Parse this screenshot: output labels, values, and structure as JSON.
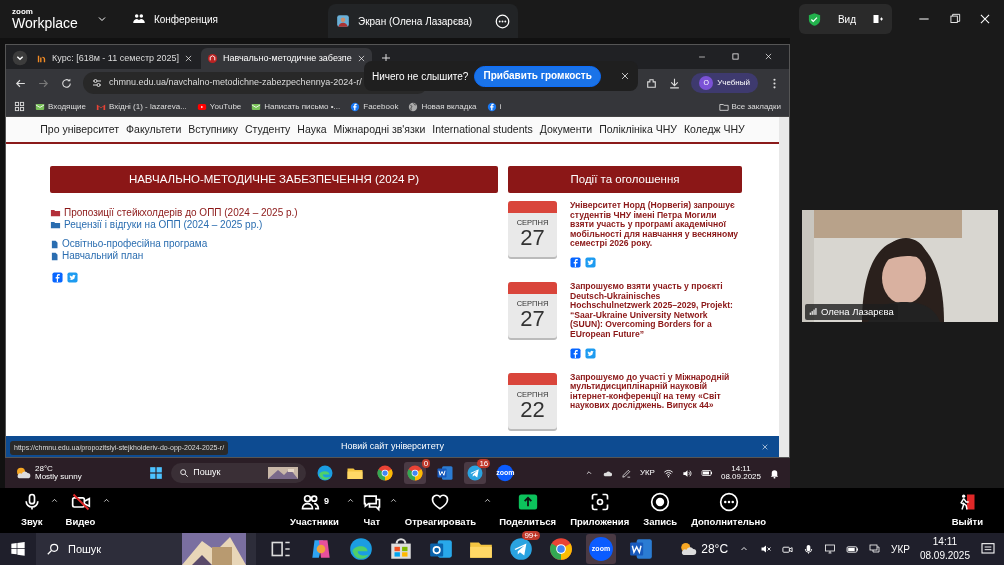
{
  "top_bar": {
    "logo_top": "zoom",
    "logo_bottom": "Workplace",
    "meeting": "Конференция",
    "share_tab": "Экран (Олена Лазарєва)",
    "view_button": "Вид"
  },
  "browser": {
    "tabs": [
      {
        "title": "Курс: [618м - 11 семестр 2025]",
        "selected": false,
        "kind": "course"
      },
      {
        "title": "Навчально-методичне забезпе",
        "selected": true,
        "kind": "site"
      }
    ],
    "url": "chmnu.edu.ua/navchalno-metodichne-zabezpechennya-2024-r/",
    "popup": {
      "message": "Ничего не слышите?",
      "button": "Прибавить громкость"
    },
    "profile_initial": "О",
    "profile": "Учебный",
    "bookmarks": [
      {
        "label": "Входящие",
        "kind": "mail"
      },
      {
        "label": "Вхідні (1) - lazareva...",
        "kind": "gmail"
      },
      {
        "label": "YouTube",
        "kind": "youtube"
      },
      {
        "label": "Написать письмо •...",
        "kind": "mail"
      },
      {
        "label": "Facebook",
        "kind": "facebook"
      },
      {
        "label": "Новая вкладка",
        "kind": "globe"
      },
      {
        "label": "i",
        "kind": "facebook"
      }
    ],
    "all_bookmarks": "Все закладки"
  },
  "site": {
    "nav": [
      "Про університет",
      "Факультети",
      "Вступнику",
      "Студенту",
      "Наука",
      "Міжнародні зв'язки",
      "International students",
      "Документи",
      "Поліклініка ЧНУ",
      "Коледж ЧНУ"
    ],
    "main_heading": "НАВЧАЛЬНО-МЕТОДИЧНЕ ЗАБЕЗПЕЧЕННЯ (2024 Р)",
    "documents": [
      {
        "text": "Пропозиції стейкхолдерів до ОПП (2024 – 2025 р.)",
        "kind": "folder",
        "hovered": true
      },
      {
        "text": "Рецензії і відгуки на ОПП (2024 – 2025 рр.)",
        "kind": "folder",
        "hovered": false
      },
      {
        "text": "Освітньо-професійна програма",
        "kind": "file",
        "hovered": false
      },
      {
        "text": "Навчальний план",
        "kind": "file",
        "hovered": false
      }
    ],
    "events_heading": "Події та оголошення",
    "events": [
      {
        "month": "СЕРПНЯ",
        "day": "27",
        "title": "Університет Норд (Норвегія) запрошує студентів ЧНУ імені Петра Могили взяти участь у програмі академічної мобільності для навчання у весняному семестрі 2026 року.",
        "share": true
      },
      {
        "month": "СЕРПНЯ",
        "day": "27",
        "title": "Запрошуємо взяти участь у проєкті Deutsch-Ukrainisches Hochschulnetzwerk 2025–2029, Projekt: “Saar-Ukraine University Network (SUUN): Overcoming Borders for a EUropean Future”",
        "share": true
      },
      {
        "month": "СЕРПНЯ",
        "day": "22",
        "title": "Запрошуємо до участі у Міжнародній мультидисциплінарній науковій інтернет-конференції на тему «Світ наукових досліджень. Випуск 44»",
        "share": false
      }
    ],
    "banner": "Новий сайт університету",
    "status_url": "https://chmnu.edu.ua/propozitsiyi-stejkholderiv-do-opp-2024-2025-r/"
  },
  "remote_taskbar": {
    "temperature": "28°C",
    "weather": "Mostly sunny",
    "search": "Пошук",
    "apps": [
      {
        "kind": "edge",
        "selected": false
      },
      {
        "kind": "files",
        "selected": false
      },
      {
        "kind": "chrome",
        "selected": false
      },
      {
        "kind": "chrome-profile",
        "selected": true,
        "badge": "0"
      },
      {
        "kind": "word",
        "selected": false
      },
      {
        "kind": "telegram",
        "selected": true,
        "badge": "16"
      },
      {
        "kind": "zoom",
        "selected": false,
        "label": "zoom"
      }
    ],
    "language": "УКР",
    "time": "14:11",
    "date": "08.09.2025"
  },
  "video": {
    "name": "Олена Лазарєва"
  },
  "zoom_toolbar": [
    {
      "kind": "audio",
      "label": "Звук",
      "caret": true
    },
    {
      "kind": "video",
      "label": "Видео",
      "caret": true,
      "off": true
    },
    {
      "kind": "participants",
      "label": "Участники",
      "caret": true,
      "count": "9"
    },
    {
      "kind": "chat",
      "label": "Чат",
      "caret": true
    },
    {
      "kind": "react",
      "label": "Отреагировать",
      "caret": true
    },
    {
      "kind": "share",
      "label": "Поделиться",
      "caret": false
    },
    {
      "kind": "apps",
      "label": "Приложения",
      "caret": false
    },
    {
      "kind": "record",
      "label": "Запись",
      "caret": false
    },
    {
      "kind": "more",
      "label": "Дополнительно",
      "caret": false
    },
    {
      "kind": "leave",
      "label": "Выйти",
      "caret": false
    }
  ],
  "taskbar": {
    "search": "Пошук",
    "apps": [
      {
        "kind": "taskview",
        "selected": false
      },
      {
        "kind": "copilot",
        "selected": false
      },
      {
        "kind": "edge",
        "selected": false
      },
      {
        "kind": "store",
        "selected": false
      },
      {
        "kind": "outlook",
        "selected": false
      },
      {
        "kind": "files",
        "selected": false
      },
      {
        "kind": "telegram",
        "selected": false,
        "badge": "99+"
      },
      {
        "kind": "chrome",
        "selected": false
      },
      {
        "kind": "zoom",
        "selected": true,
        "label": "zoom"
      },
      {
        "kind": "word",
        "selected": false
      }
    ],
    "temperature": "28°C",
    "language": "УКР",
    "time": "14:11",
    "date": "08.09.2025"
  }
}
